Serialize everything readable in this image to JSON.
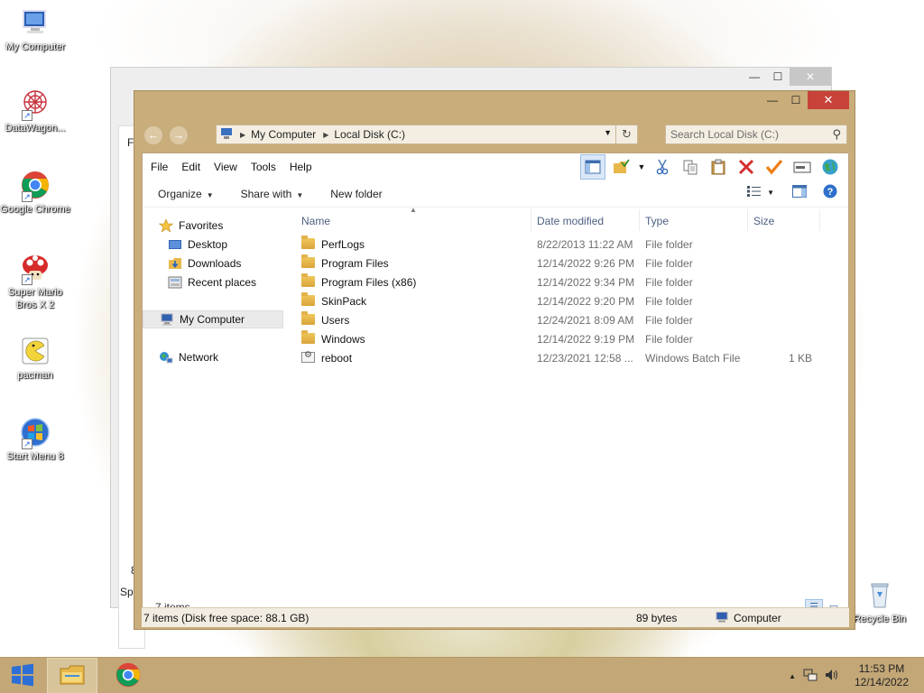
{
  "desktop": {
    "icons": [
      {
        "label": "My Computer",
        "icon": "computer-icon"
      },
      {
        "label": "DataWagon...",
        "icon": "datawagon-icon"
      },
      {
        "label": "Google Chrome",
        "icon": "chrome-icon"
      },
      {
        "label": "Super Mario Bros X 2",
        "icon": "mario-icon"
      },
      {
        "label": "pacman",
        "icon": "pacman-icon"
      },
      {
        "label": "Start Menu 8",
        "icon": "start-menu-icon"
      },
      {
        "label": "Recycle Bin",
        "icon": "recycle-bin-icon"
      }
    ]
  },
  "background_window": {
    "fragments": [
      "Fi",
      "8",
      "Spa"
    ]
  },
  "window": {
    "caption_buttons": {
      "minimize": "—",
      "maximize": "☐",
      "close": "✕"
    },
    "address": {
      "segments": [
        "My Computer",
        "Local Disk (C:)"
      ],
      "search_placeholder": "Search Local Disk (C:)"
    },
    "menu": [
      "File",
      "Edit",
      "View",
      "Tools",
      "Help"
    ],
    "commands": {
      "organize": "Organize",
      "share_with": "Share with",
      "new_folder": "New folder"
    },
    "nav": {
      "favorites": "Favorites",
      "desktop": "Desktop",
      "downloads": "Downloads",
      "recent_places": "Recent places",
      "my_computer": "My Computer",
      "network": "Network"
    },
    "columns": {
      "name": "Name",
      "date": "Date modified",
      "type": "Type",
      "size": "Size"
    },
    "files": [
      {
        "name": "PerfLogs",
        "date": "8/22/2013 11:22 AM",
        "type": "File folder",
        "size": "",
        "kind": "folder"
      },
      {
        "name": "Program Files",
        "date": "12/14/2022 9:26 PM",
        "type": "File folder",
        "size": "",
        "kind": "folder"
      },
      {
        "name": "Program Files (x86)",
        "date": "12/14/2022 9:34 PM",
        "type": "File folder",
        "size": "",
        "kind": "folder"
      },
      {
        "name": "SkinPack",
        "date": "12/14/2022 9:20 PM",
        "type": "File folder",
        "size": "",
        "kind": "folder"
      },
      {
        "name": "Users",
        "date": "12/24/2021 8:09 AM",
        "type": "File folder",
        "size": "",
        "kind": "folder"
      },
      {
        "name": "Windows",
        "date": "12/14/2022 9:19 PM",
        "type": "File folder",
        "size": "",
        "kind": "folder"
      },
      {
        "name": "reboot",
        "date": "12/23/2021 12:58 ...",
        "type": "Windows Batch File",
        "size": "1 KB",
        "kind": "batch"
      }
    ],
    "item_count": "7 items",
    "status": {
      "left": "7 items (Disk free space: 88.1 GB)",
      "middle": "89 bytes",
      "right": "Computer"
    }
  },
  "taskbar": {
    "clock": {
      "time": "11:53 PM",
      "date": "12/14/2022"
    },
    "tray_expand": "▲"
  },
  "colors": {
    "frame": "#c9ad7b",
    "taskbar": "#c3a777",
    "close": "#c7433a",
    "selection": "#d9e7f7"
  }
}
